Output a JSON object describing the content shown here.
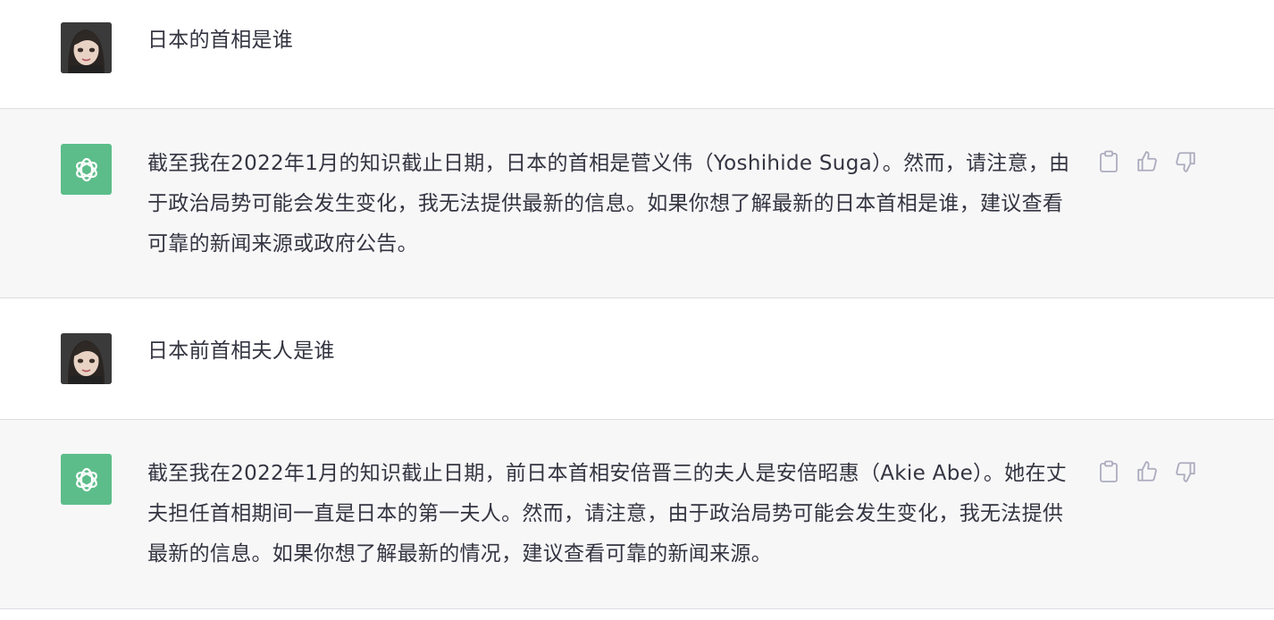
{
  "messages": [
    {
      "role": "user",
      "avatar_icon": "user-avatar",
      "text": "日本的首相是谁"
    },
    {
      "role": "assistant",
      "avatar_icon": "openai-logo-icon",
      "text": "截至我在2022年1月的知识截止日期，日本的首相是菅义伟（Yoshihide Suga）。然而，请注意，由于政治局势可能会发生变化，我无法提供最新的信息。如果你想了解最新的日本首相是谁，建议查看可靠的新闻来源或政府公告。",
      "actions": [
        "clipboard-icon",
        "thumbs-up-icon",
        "thumbs-down-icon"
      ]
    },
    {
      "role": "user",
      "avatar_icon": "user-avatar",
      "text": "日本前首相夫人是谁"
    },
    {
      "role": "assistant",
      "avatar_icon": "openai-logo-icon",
      "text": "截至我在2022年1月的知识截止日期，前日本首相安倍晋三的夫人是安倍昭惠（Akie Abe）。她在丈夫担任首相期间一直是日本的第一夫人。然而，请注意，由于政治局势可能会发生变化，我无法提供最新的信息。如果你想了解最新的情况，建议查看可靠的新闻来源。",
      "actions": [
        "clipboard-icon",
        "thumbs-up-icon",
        "thumbs-down-icon"
      ]
    }
  ],
  "colors": {
    "assistant_bg": "#f7f7f8",
    "user_bg": "#ffffff",
    "bot_avatar": "#5cbd8a",
    "text": "#343541",
    "icon": "#acacbe"
  }
}
